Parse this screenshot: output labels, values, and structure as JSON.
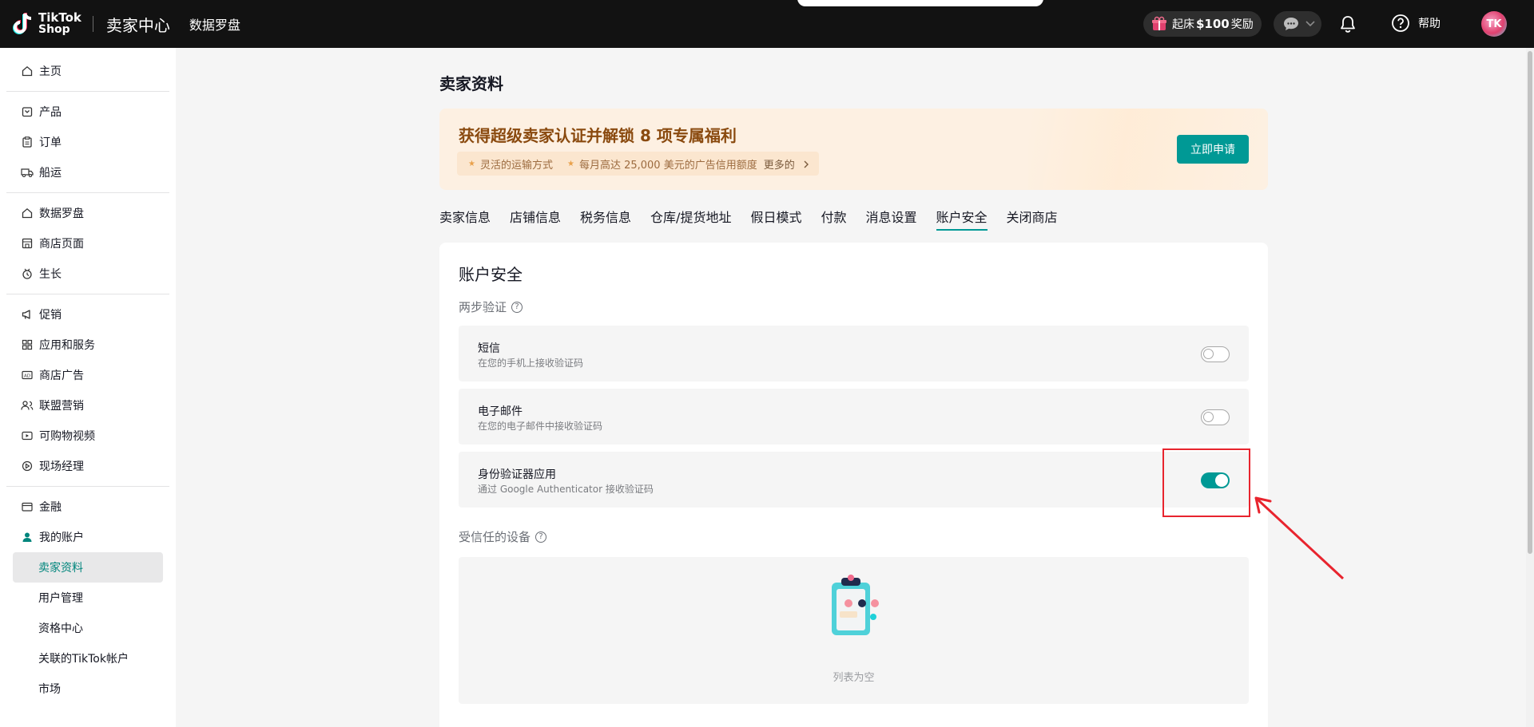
{
  "topbar": {
    "brand_line1": "TikTok",
    "brand_line2": "Shop",
    "title": "卖家中心",
    "nav": "数据罗盘",
    "reward_prefix": "起床",
    "reward_amount": "$100",
    "reward_suffix": "奖励",
    "help": "帮助",
    "avatar_text": "TK"
  },
  "sidebar": {
    "groups": [
      [
        {
          "label": "主页",
          "icon": "home-icon"
        }
      ],
      [
        {
          "label": "产品",
          "icon": "product-icon"
        },
        {
          "label": "订单",
          "icon": "order-icon"
        },
        {
          "label": "船运",
          "icon": "shipping-icon"
        }
      ],
      [
        {
          "label": "数据罗盘",
          "icon": "compass-icon"
        },
        {
          "label": "商店页面",
          "icon": "store-icon"
        },
        {
          "label": "生长",
          "icon": "growth-icon"
        }
      ],
      [
        {
          "label": "促销",
          "icon": "promotion-icon"
        },
        {
          "label": "应用和服务",
          "icon": "apps-icon"
        },
        {
          "label": "商店广告",
          "icon": "ads-icon"
        },
        {
          "label": "联盟营销",
          "icon": "affiliate-icon"
        },
        {
          "label": "可购物视频",
          "icon": "video-icon"
        },
        {
          "label": "现场经理",
          "icon": "live-icon"
        }
      ],
      [
        {
          "label": "金融",
          "icon": "finance-icon"
        },
        {
          "label": "我的账户",
          "icon": "account-icon"
        }
      ]
    ],
    "account_sub": [
      "卖家资料",
      "用户管理",
      "资格中心",
      "关联的TikTok帐户",
      "市场"
    ]
  },
  "page": {
    "title": "卖家资料",
    "banner": {
      "title": "获得超级卖家认证并解锁 8 项专属福利",
      "benefit1": "灵活的运输方式",
      "benefit2": "每月高达 25,000 美元的广告信用额度",
      "more": "更多的",
      "button": "立即申请"
    },
    "tabs": [
      "卖家信息",
      "店铺信息",
      "税务信息",
      "仓库/提货地址",
      "假日模式",
      "付款",
      "消息设置",
      "账户安全",
      "关闭商店"
    ],
    "active_tab": "账户安全"
  },
  "security": {
    "title": "账户安全",
    "two_step_label": "两步验证",
    "methods": [
      {
        "title": "短信",
        "desc": "在您的手机上接收验证码",
        "enabled": false
      },
      {
        "title": "电子邮件",
        "desc": "在您的电子邮件中接收验证码",
        "enabled": false
      },
      {
        "title": "身份验证器应用",
        "desc": "通过 Google Authenticator 接收验证码",
        "enabled": true
      }
    ],
    "trusted_label": "受信任的设备",
    "empty_text": "列表为空"
  },
  "colors": {
    "accent": "#009995",
    "annotation": "#e8242e"
  }
}
